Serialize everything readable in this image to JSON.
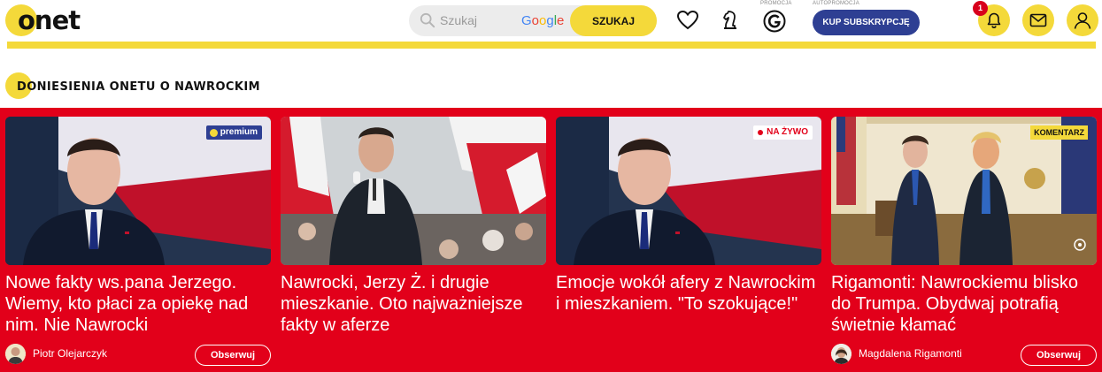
{
  "header": {
    "logo_text": "onet",
    "search": {
      "placeholder": "Szukaj",
      "provider": "Google",
      "button_label": "SZUKAJ"
    },
    "promo_label": "PROMOCJA",
    "autopromo_label": "AUTOPROMOCJA",
    "subscribe_label": "KUP SUBSKRYPCJĘ",
    "notifications_count": "1"
  },
  "section": {
    "title": "DONIESIENIA ONETU O NAWROCKIM"
  },
  "cards": [
    {
      "badge": "premium",
      "title": "Nowe fakty ws.pana Jerzego. Wiemy, kto płaci za opiekę nad nim. Nie Nawrocki",
      "author": "Piotr Olejarczyk",
      "follow_label": "Obserwuj"
    },
    {
      "badge": "",
      "title": "Nawrocki, Jerzy Ż. i drugie mieszkanie. Oto najważniejsze fakty w aferze",
      "author": "",
      "follow_label": ""
    },
    {
      "badge": "NA ŻYWO",
      "title": "Emocje wokół afery z Nawrockim i mieszkaniem. \"To szokujące!\"",
      "author": "",
      "follow_label": ""
    },
    {
      "badge": "KOMENTARZ",
      "title": "Rigamonti: Nawrockiemu blisko do Trumpa. Obydwaj potrafią świetnie kłamać",
      "author": "Magdalena Rigamonti",
      "follow_label": "Obserwuj"
    }
  ],
  "colors": {
    "brand_yellow": "#f4d93a",
    "strip_red": "#e2001a",
    "subscribe_blue": "#2e3f93"
  },
  "icons": [
    "search-icon",
    "heart-icon",
    "chess-knight-icon",
    "g-logo-icon",
    "bell-icon",
    "mail-icon",
    "user-icon",
    "gallery-icon"
  ]
}
